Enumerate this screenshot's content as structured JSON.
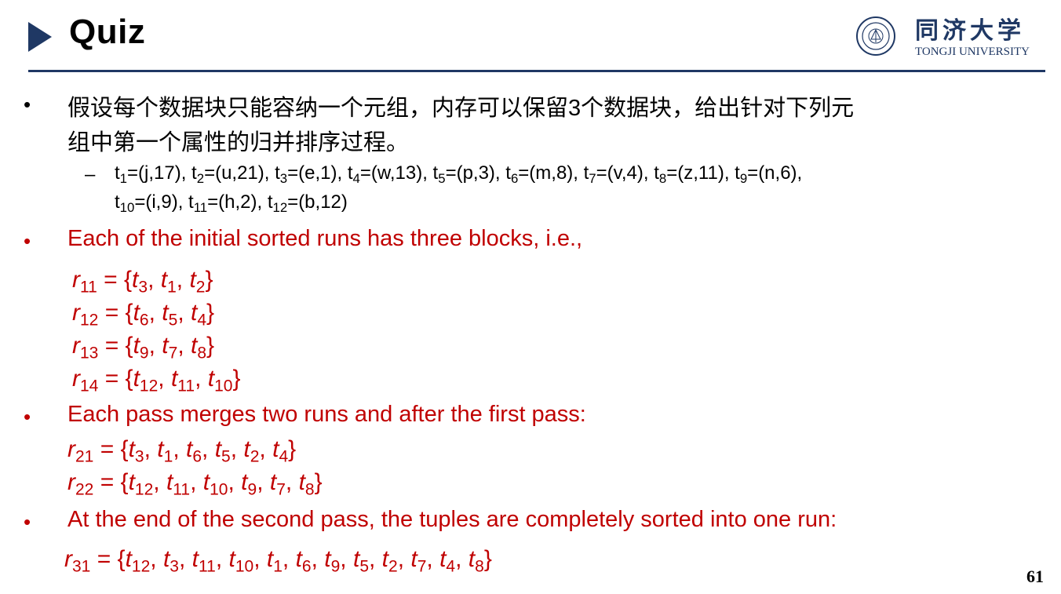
{
  "header": {
    "title": "Quiz",
    "logo_cn": "同济大学",
    "logo_en": "TONGJI UNIVERSITY"
  },
  "question": {
    "line1": "假设每个数据块只能容纳一个元组，内存可以保留3个数据块，给出针对下列元",
    "line2": "组中第一个属性的归并排序过程。"
  },
  "bullets": {
    "b1": "Each of the initial sorted runs has three blocks, i.e.,",
    "b2": "Each pass merges two runs and after the first pass:",
    "b3": "At the end of the second pass, the tuples are completely sorted into one run:"
  },
  "page_number": "61",
  "colors": {
    "accent": "#1f3864",
    "answer": "#c00000"
  }
}
